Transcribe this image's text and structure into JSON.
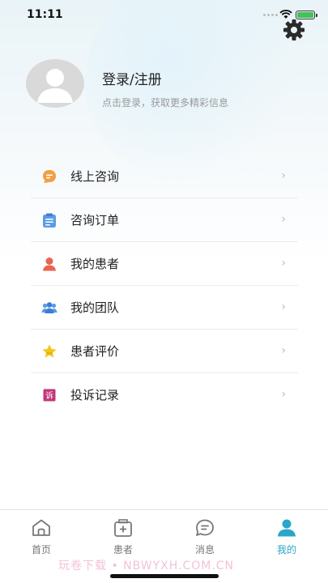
{
  "status_bar": {
    "time": "11:11"
  },
  "profile": {
    "title": "登录/注册",
    "subtitle": "点击登录，获取更多精彩信息"
  },
  "menu": [
    {
      "label": "线上咨询",
      "icon": "chat-bubble-icon"
    },
    {
      "label": "咨询订单",
      "icon": "clipboard-icon"
    },
    {
      "label": "我的患者",
      "icon": "person-icon"
    },
    {
      "label": "我的团队",
      "icon": "team-icon"
    },
    {
      "label": "患者评价",
      "icon": "star-icon"
    },
    {
      "label": "投诉记录",
      "icon": "complaint-icon",
      "badge_text": "诉"
    }
  ],
  "tabbar": [
    {
      "label": "首页",
      "icon": "home-icon",
      "active": false
    },
    {
      "label": "患者",
      "icon": "medical-kit-icon",
      "active": false
    },
    {
      "label": "消息",
      "icon": "message-icon",
      "active": false
    },
    {
      "label": "我的",
      "icon": "profile-icon",
      "active": true
    }
  ],
  "watermark": "玩卷下载 • NBWYXH.COM.CN",
  "colors": {
    "accent": "#2aa6c8",
    "orange": "#f0a040",
    "blue": "#5b9be6",
    "red": "#ea6452",
    "yellow": "#f5c51b",
    "pink": "#c2357a"
  }
}
